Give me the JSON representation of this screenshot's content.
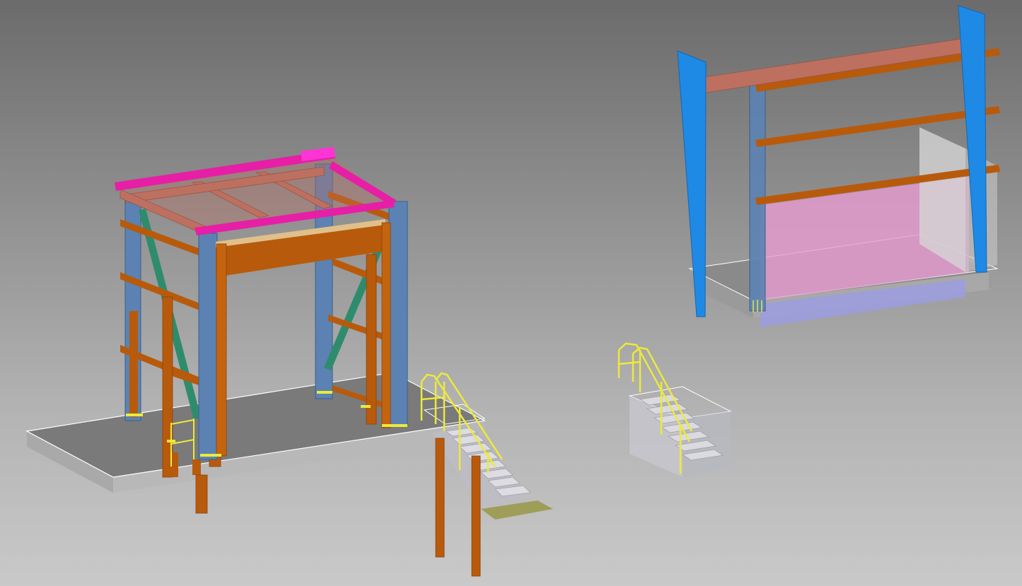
{
  "viewport": {
    "name": "3D model view",
    "background_top": "#6b6b6b",
    "background_bottom": "#c9c9c9"
  },
  "colors": {
    "column_blue": "#5b82b2",
    "beam_orange": "#b85a0c",
    "beam_salmon": "#bd7060",
    "magenta": "#e61fa6",
    "brace_green": "#2e8c6c",
    "handrail_yellow": "#ecea3a",
    "slab_gray": "#9a9a9a",
    "stair_gray": "#cfcfd6",
    "tapered_blue": "#1e8ae6",
    "pink_panel": "#e79bd0",
    "lavender": "#9c9ce0",
    "outline_white": "#ffffff"
  },
  "models": [
    {
      "id": "steel-frame-structure",
      "icon": "steel-frame-icon"
    },
    {
      "id": "staircase-with-handrail",
      "icon": "stair-icon"
    },
    {
      "id": "small-staircase",
      "icon": "stair-icon"
    },
    {
      "id": "portal-frame-with-girts",
      "icon": "portal-frame-icon"
    }
  ]
}
